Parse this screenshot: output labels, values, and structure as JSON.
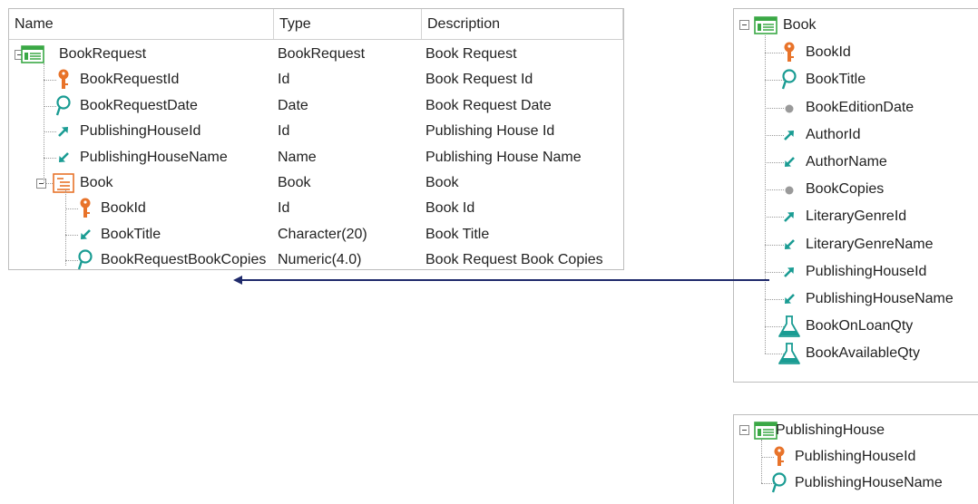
{
  "grid": {
    "headers": [
      "Name",
      "Type",
      "Description"
    ],
    "rows": [
      {
        "name": "BookRequest",
        "type": "BookRequest",
        "description": "Book Request",
        "icon": "transaction-icon",
        "level": 0
      },
      {
        "name": "BookRequestId",
        "type": "Id",
        "description": "Book Request Id",
        "icon": "primary-key-icon",
        "level": 1
      },
      {
        "name": "BookRequestDate",
        "type": "Date",
        "description": "Book Request Date",
        "icon": "description-attribute-icon",
        "level": 1
      },
      {
        "name": "PublishingHouseId",
        "type": "Id",
        "description": "Publishing House Id",
        "icon": "foreign-key-icon",
        "level": 1
      },
      {
        "name": "PublishingHouseName",
        "type": "Name",
        "description": "Publishing House Name",
        "icon": "inferred-attribute-icon",
        "level": 1
      },
      {
        "name": "Book",
        "type": "Book",
        "description": "Book",
        "icon": "level-icon",
        "level": 1
      },
      {
        "name": "BookId",
        "type": "Id",
        "description": "Book Id",
        "icon": "primary-key-icon",
        "level": 2
      },
      {
        "name": "BookTitle",
        "type": "Character(20)",
        "description": "Book Title",
        "icon": "inferred-attribute-icon",
        "level": 2
      },
      {
        "name": "BookRequestBookCopies",
        "type": "Numeric(4.0)",
        "description": "Book Request Book Copies",
        "icon": "description-attribute-icon",
        "level": 2
      }
    ]
  },
  "book_tree": {
    "root": "Book",
    "items": [
      {
        "name": "BookId",
        "icon": "primary-key-icon"
      },
      {
        "name": "BookTitle",
        "icon": "description-attribute-icon"
      },
      {
        "name": "BookEditionDate",
        "icon": "attribute-dot-icon"
      },
      {
        "name": "AuthorId",
        "icon": "foreign-key-icon"
      },
      {
        "name": "AuthorName",
        "icon": "inferred-attribute-icon"
      },
      {
        "name": "BookCopies",
        "icon": "attribute-dot-icon"
      },
      {
        "name": "LiteraryGenreId",
        "icon": "foreign-key-icon"
      },
      {
        "name": "LiteraryGenreName",
        "icon": "inferred-attribute-icon"
      },
      {
        "name": "PublishingHouseId",
        "icon": "foreign-key-icon"
      },
      {
        "name": "PublishingHouseName",
        "icon": "inferred-attribute-icon"
      },
      {
        "name": "BookOnLoanQty",
        "icon": "formula-flask-icon"
      },
      {
        "name": "BookAvailableQty",
        "icon": "formula-flask-icon"
      }
    ]
  },
  "publishing_house_tree": {
    "root": "PublishingHouse",
    "items": [
      {
        "name": "PublishingHouseId",
        "icon": "primary-key-icon"
      },
      {
        "name": "PublishingHouseName",
        "icon": "description-attribute-icon"
      }
    ]
  },
  "colors": {
    "key_orange": "#e8732a",
    "teal": "#1a9c93",
    "green": "#3aa845",
    "arrow_navy": "#1f2a6b",
    "dot_gray": "#9a9a9a"
  }
}
